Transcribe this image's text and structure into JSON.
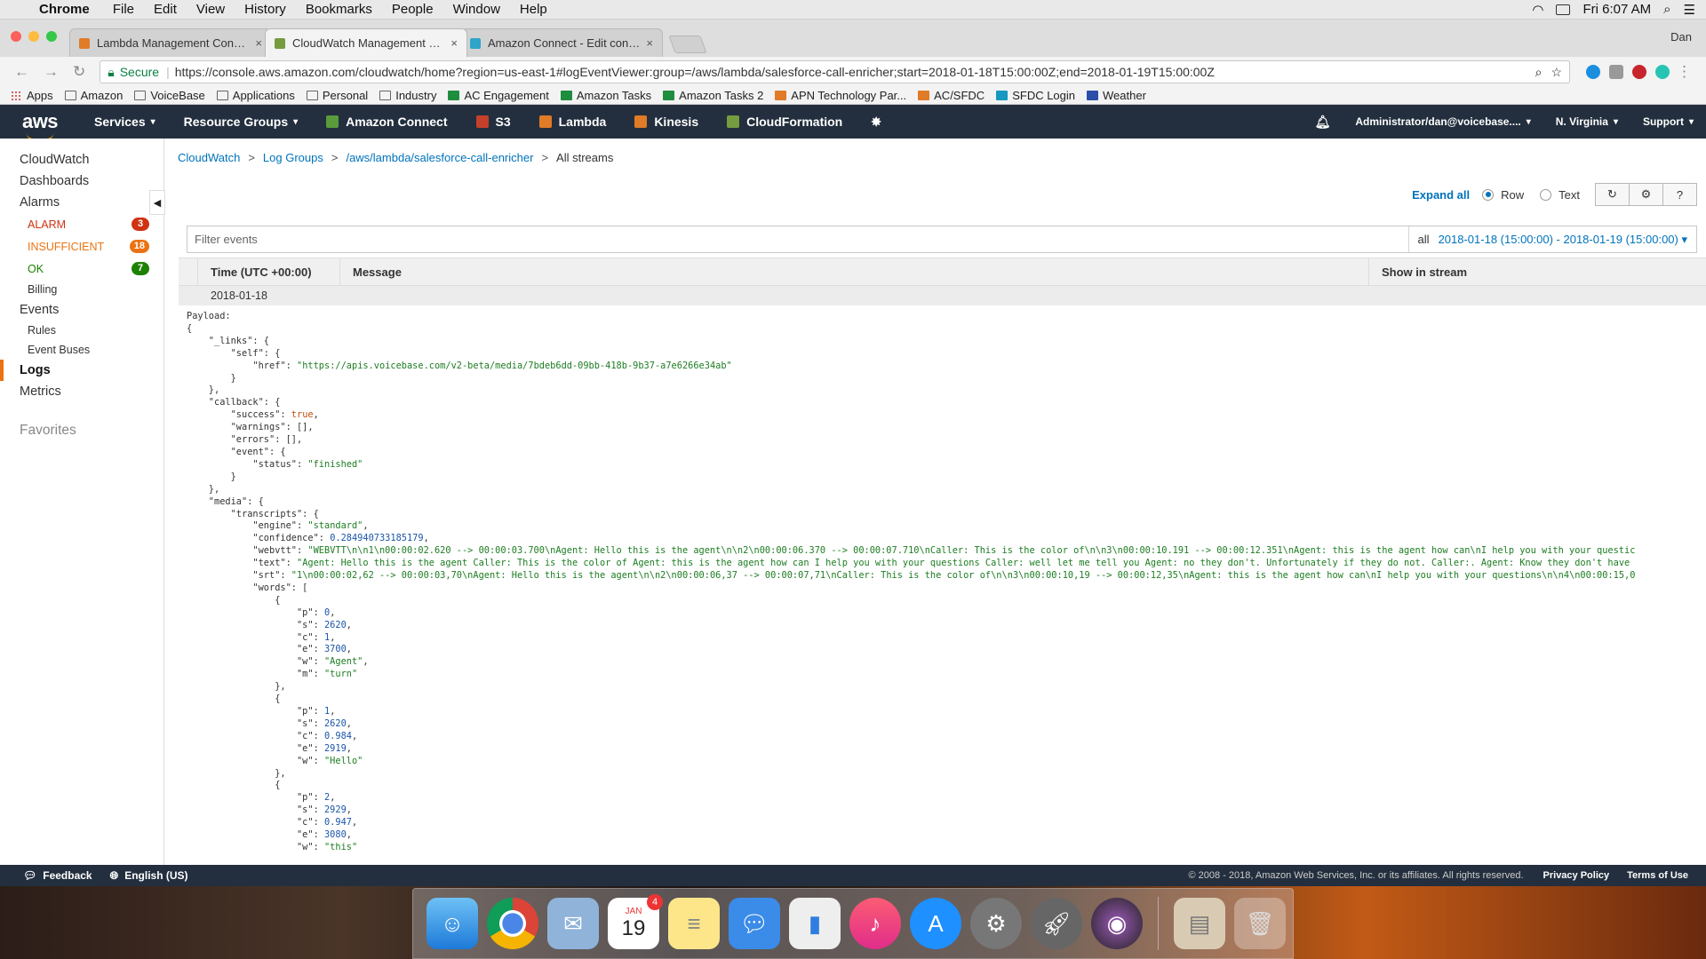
{
  "macos": {
    "app_name": "Chrome",
    "menus": [
      "File",
      "Edit",
      "View",
      "History",
      "Bookmarks",
      "People",
      "Window",
      "Help"
    ],
    "clock": "Fri 6:07 AM"
  },
  "browser": {
    "user": "Dan",
    "tabs": [
      {
        "title": "Lambda Management Console",
        "favicon_color": "#e07b27"
      },
      {
        "title": "CloudWatch Management Con",
        "favicon_color": "#759c3e"
      },
      {
        "title": "Amazon Connect - Edit contac",
        "favicon_color": "#2ea5c9"
      }
    ],
    "secure_label": "Secure",
    "url": "https://console.aws.amazon.com/cloudwatch/home?region=us-east-1#logEventViewer:group=/aws/lambda/salesforce-call-enricher;start=2018-01-18T15:00:00Z;end=2018-01-19T15:00:00Z",
    "bookmarks": [
      "Apps",
      "Amazon",
      "VoiceBase",
      "Applications",
      "Personal",
      "Industry",
      "AC Engagement",
      "Amazon Tasks",
      "Amazon Tasks 2",
      "APN Technology Par...",
      "AC/SFDC",
      "SFDC Login",
      "Weather"
    ]
  },
  "aws_nav": {
    "logo": "aws",
    "services": "Services",
    "resource_groups": "Resource Groups",
    "shortcuts": [
      {
        "label": "Amazon Connect",
        "color": "#5a9b3c"
      },
      {
        "label": "S3",
        "color": "#c4402b"
      },
      {
        "label": "Lambda",
        "color": "#e07b27"
      },
      {
        "label": "Kinesis",
        "color": "#e07b27"
      },
      {
        "label": "CloudFormation",
        "color": "#759c3e"
      }
    ],
    "account": "Administrator/dan@voicebase....",
    "region": "N. Virginia",
    "support": "Support"
  },
  "sidebar": {
    "cloudwatch": "CloudWatch",
    "dashboards": "Dashboards",
    "alarms": "Alarms",
    "alarm_items": [
      {
        "label": "ALARM",
        "count": "3",
        "color": "#d13212"
      },
      {
        "label": "INSUFFICIENT",
        "count": "18",
        "color": "#ec7211"
      },
      {
        "label": "OK",
        "count": "7",
        "color": "#1d8102"
      }
    ],
    "billing": "Billing",
    "events": "Events",
    "rules": "Rules",
    "event_buses": "Event Buses",
    "logs": "Logs",
    "metrics": "Metrics",
    "favorites": "Favorites"
  },
  "breadcrumb": {
    "items": [
      "CloudWatch",
      "Log Groups",
      "/aws/lambda/salesforce-call-enricher"
    ],
    "current": "All streams"
  },
  "toolbar": {
    "expand_all": "Expand all",
    "row": "Row",
    "text": "Text"
  },
  "filter": {
    "placeholder": "Filter events",
    "all": "all",
    "range": "2018-01-18 (15:00:00) - 2018-01-19 (15:00:00) ▾"
  },
  "table": {
    "col_time": "Time (UTC +00:00)",
    "col_message": "Message",
    "col_stream": "Show in stream",
    "date": "2018-01-18"
  },
  "log_lines": [
    [
      {
        "t": "Payload:",
        "c": ""
      }
    ],
    [
      {
        "t": "{",
        "c": ""
      }
    ],
    [
      {
        "t": "    \"_links\": {",
        "c": ""
      }
    ],
    [
      {
        "t": "        \"self\": {",
        "c": ""
      }
    ],
    [
      {
        "t": "            \"href\": ",
        "c": ""
      },
      {
        "t": "\"https://apis.voicebase.com/v2-beta/media/7bdeb6dd-09bb-418b-9b37-a7e6266e34ab\"",
        "c": "s"
      }
    ],
    [
      {
        "t": "        }",
        "c": ""
      }
    ],
    [
      {
        "t": "    },",
        "c": ""
      }
    ],
    [
      {
        "t": "    \"callback\": {",
        "c": ""
      }
    ],
    [
      {
        "t": "        \"success\": ",
        "c": ""
      },
      {
        "t": "true",
        "c": "b"
      },
      {
        "t": ",",
        "c": ""
      }
    ],
    [
      {
        "t": "        \"warnings\": [],",
        "c": ""
      }
    ],
    [
      {
        "t": "        \"errors\": [],",
        "c": ""
      }
    ],
    [
      {
        "t": "        \"event\": {",
        "c": ""
      }
    ],
    [
      {
        "t": "            \"status\": ",
        "c": ""
      },
      {
        "t": "\"finished\"",
        "c": "s"
      }
    ],
    [
      {
        "t": "        }",
        "c": ""
      }
    ],
    [
      {
        "t": "    },",
        "c": ""
      }
    ],
    [
      {
        "t": "    \"media\": {",
        "c": ""
      }
    ],
    [
      {
        "t": "        \"transcripts\": {",
        "c": ""
      }
    ],
    [
      {
        "t": "            \"engine\": ",
        "c": ""
      },
      {
        "t": "\"standard\"",
        "c": "s"
      },
      {
        "t": ",",
        "c": ""
      }
    ],
    [
      {
        "t": "            \"confidence\": ",
        "c": ""
      },
      {
        "t": "0.284940733185179",
        "c": "n"
      },
      {
        "t": ",",
        "c": ""
      }
    ],
    [
      {
        "t": "            \"webvtt\": ",
        "c": ""
      },
      {
        "t": "\"WEBVTT\\n\\n1\\n00:00:02.620 --> 00:00:03.700\\nAgent: Hello this is the agent\\n\\n2\\n00:00:06.370 --> 00:00:07.710\\nCaller: This is the color of\\n\\n3\\n00:00:10.191 --> 00:00:12.351\\nAgent: this is the agent how can\\nI help you with your questic",
        "c": "s"
      }
    ],
    [
      {
        "t": "            \"text\": ",
        "c": ""
      },
      {
        "t": "\"Agent: Hello this is the agent Caller: This is the color of Agent: this is the agent how can I help you with your questions Caller: well let me tell you Agent: no they don't. Unfortunately if they do not. Caller:. Agent: Know they don't have",
        "c": "s"
      }
    ],
    [
      {
        "t": "            \"srt\": ",
        "c": ""
      },
      {
        "t": "\"1\\n00:00:02,62 --> 00:00:03,70\\nAgent: Hello this is the agent\\n\\n2\\n00:00:06,37 --> 00:00:07,71\\nCaller: This is the color of\\n\\n3\\n00:00:10,19 --> 00:00:12,35\\nAgent: this is the agent how can\\nI help you with your questions\\n\\n4\\n00:00:15,0",
        "c": "s"
      }
    ],
    [
      {
        "t": "            \"words\": [",
        "c": ""
      }
    ],
    [
      {
        "t": "                {",
        "c": ""
      }
    ],
    [
      {
        "t": "                    \"p\": ",
        "c": ""
      },
      {
        "t": "0",
        "c": "n"
      },
      {
        "t": ",",
        "c": ""
      }
    ],
    [
      {
        "t": "                    \"s\": ",
        "c": ""
      },
      {
        "t": "2620",
        "c": "n"
      },
      {
        "t": ",",
        "c": ""
      }
    ],
    [
      {
        "t": "                    \"c\": ",
        "c": ""
      },
      {
        "t": "1",
        "c": "n"
      },
      {
        "t": ",",
        "c": ""
      }
    ],
    [
      {
        "t": "                    \"e\": ",
        "c": ""
      },
      {
        "t": "3700",
        "c": "n"
      },
      {
        "t": ",",
        "c": ""
      }
    ],
    [
      {
        "t": "                    \"w\": ",
        "c": ""
      },
      {
        "t": "\"Agent\"",
        "c": "s"
      },
      {
        "t": ",",
        "c": ""
      }
    ],
    [
      {
        "t": "                    \"m\": ",
        "c": ""
      },
      {
        "t": "\"turn\"",
        "c": "s"
      }
    ],
    [
      {
        "t": "                },",
        "c": ""
      }
    ],
    [
      {
        "t": "                {",
        "c": ""
      }
    ],
    [
      {
        "t": "                    \"p\": ",
        "c": ""
      },
      {
        "t": "1",
        "c": "n"
      },
      {
        "t": ",",
        "c": ""
      }
    ],
    [
      {
        "t": "                    \"s\": ",
        "c": ""
      },
      {
        "t": "2620",
        "c": "n"
      },
      {
        "t": ",",
        "c": ""
      }
    ],
    [
      {
        "t": "                    \"c\": ",
        "c": ""
      },
      {
        "t": "0.984",
        "c": "n"
      },
      {
        "t": ",",
        "c": ""
      }
    ],
    [
      {
        "t": "                    \"e\": ",
        "c": ""
      },
      {
        "t": "2919",
        "c": "n"
      },
      {
        "t": ",",
        "c": ""
      }
    ],
    [
      {
        "t": "                    \"w\": ",
        "c": ""
      },
      {
        "t": "\"Hello\"",
        "c": "s"
      }
    ],
    [
      {
        "t": "                },",
        "c": ""
      }
    ],
    [
      {
        "t": "                {",
        "c": ""
      }
    ],
    [
      {
        "t": "                    \"p\": ",
        "c": ""
      },
      {
        "t": "2",
        "c": "n"
      },
      {
        "t": ",",
        "c": ""
      }
    ],
    [
      {
        "t": "                    \"s\": ",
        "c": ""
      },
      {
        "t": "2929",
        "c": "n"
      },
      {
        "t": ",",
        "c": ""
      }
    ],
    [
      {
        "t": "                    \"c\": ",
        "c": ""
      },
      {
        "t": "0.947",
        "c": "n"
      },
      {
        "t": ",",
        "c": ""
      }
    ],
    [
      {
        "t": "                    \"e\": ",
        "c": ""
      },
      {
        "t": "3080",
        "c": "n"
      },
      {
        "t": ",",
        "c": ""
      }
    ],
    [
      {
        "t": "                    \"w\": ",
        "c": ""
      },
      {
        "t": "\"this\"",
        "c": "s"
      }
    ]
  ],
  "footer": {
    "feedback": "Feedback",
    "language": "English (US)",
    "copyright": "© 2008 - 2018, Amazon Web Services, Inc. or its affiliates. All rights reserved.",
    "privacy": "Privacy Policy",
    "terms": "Terms of Use"
  },
  "dock": {
    "calendar_month": "JAN",
    "calendar_day": "19",
    "calendar_badge": "4"
  }
}
